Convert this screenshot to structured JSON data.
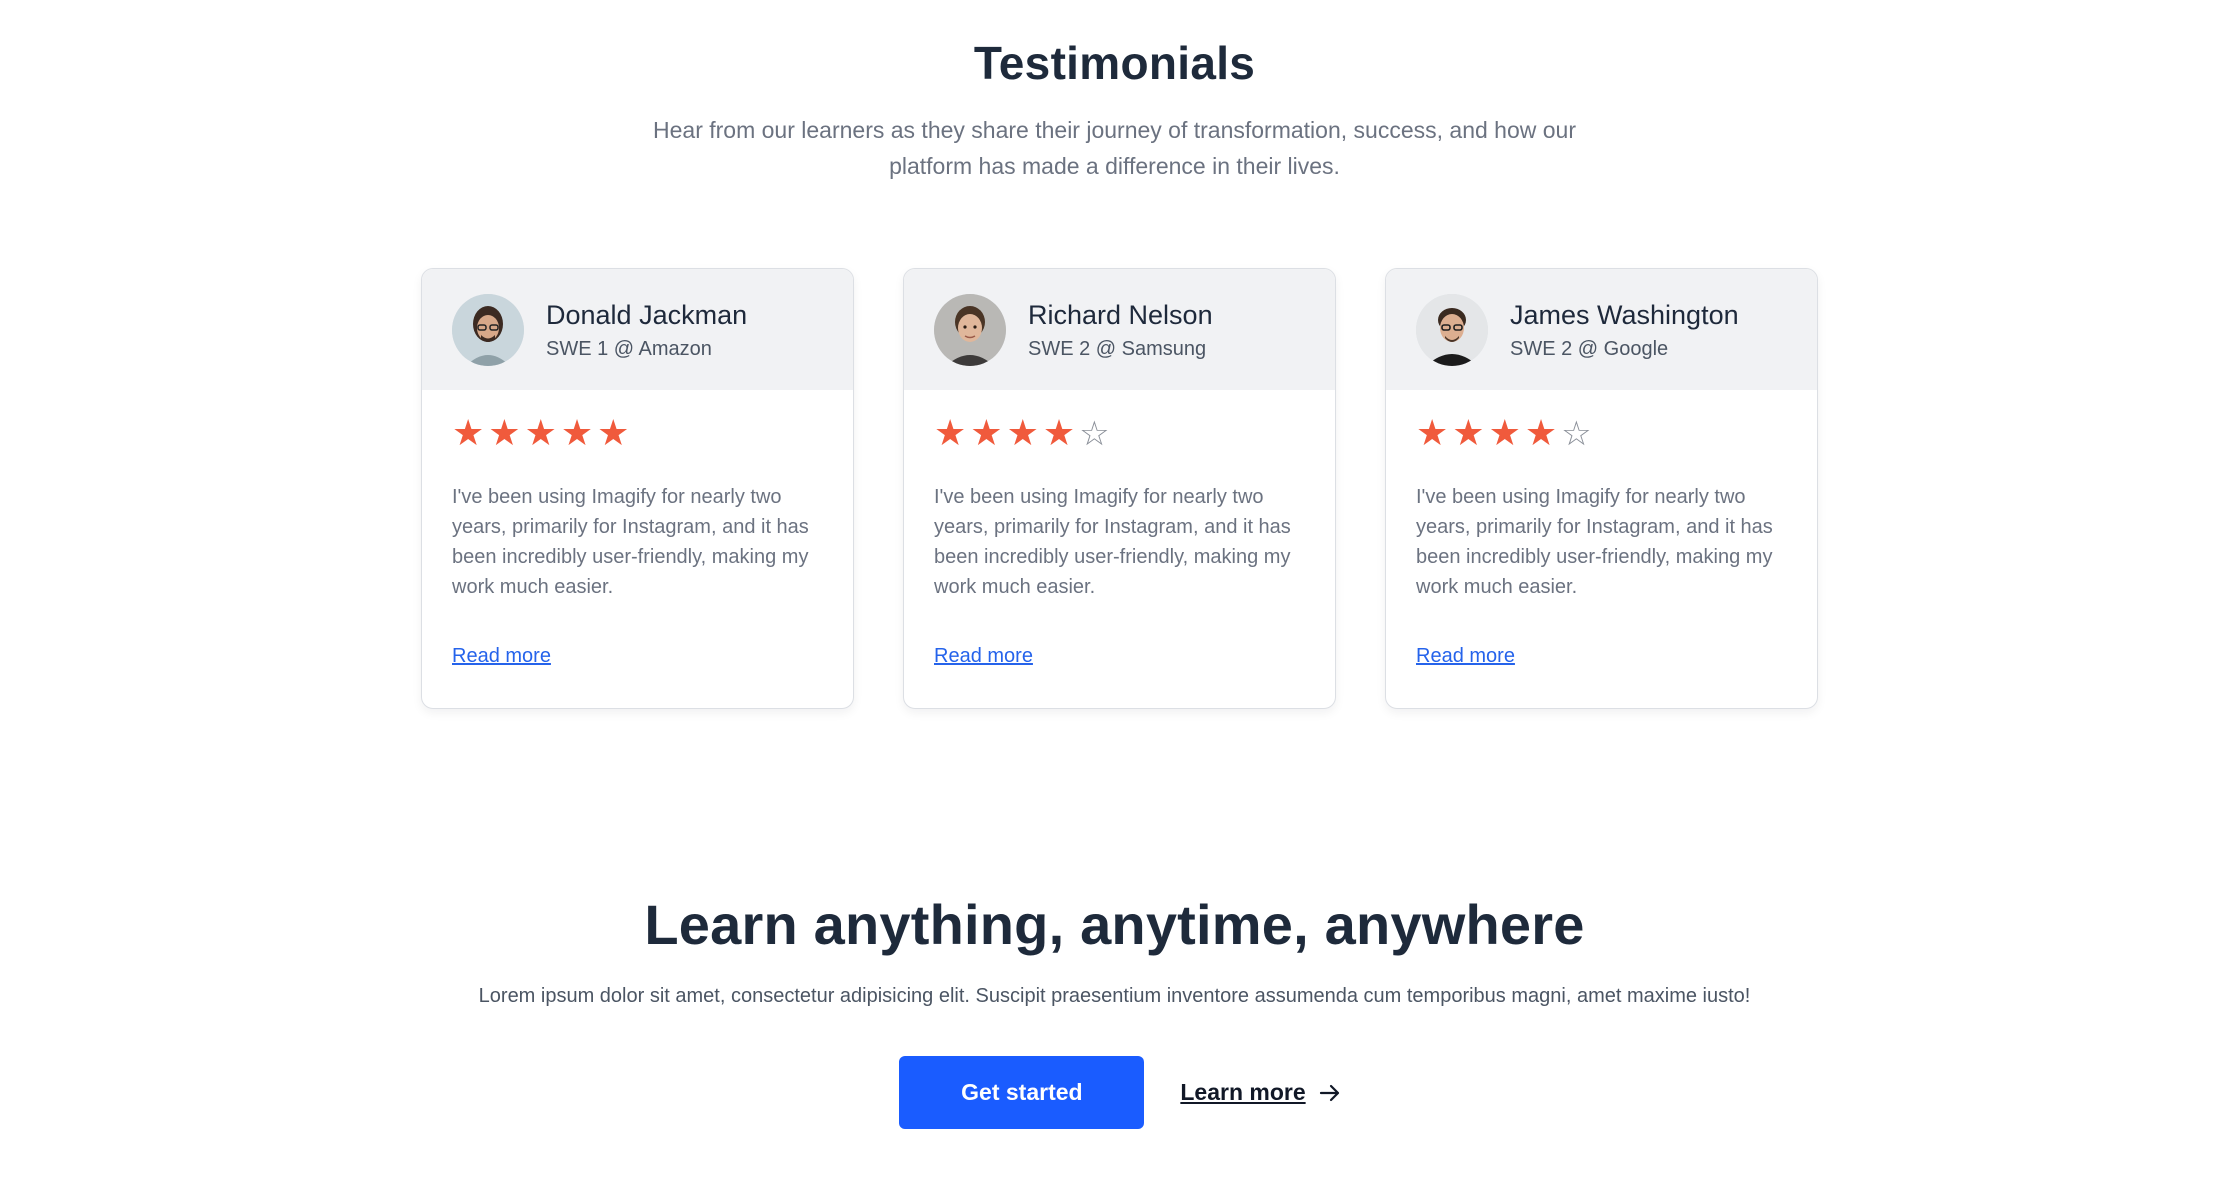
{
  "testimonials": {
    "title": "Testimonials",
    "subtitle": "Hear from our learners as they share their journey of transformation, success, and how our platform has made a difference in their lives."
  },
  "cards": [
    {
      "name": "Donald Jackman",
      "role": "SWE 1 @ Amazon",
      "rating": 5,
      "max_rating": 5,
      "stars": [
        "★",
        "★",
        "★",
        "★",
        "★"
      ],
      "quote": "I've been using Imagify for nearly two years, primarily for Instagram, and it has been incredibly user-friendly, making my work much easier.",
      "link": "Read more"
    },
    {
      "name": "Richard Nelson",
      "role": "SWE 2 @ Samsung",
      "rating": 4,
      "max_rating": 5,
      "stars": [
        "★",
        "★",
        "★",
        "★",
        "☆"
      ],
      "quote": "I've been using Imagify for nearly two years, primarily for Instagram, and it has been incredibly user-friendly, making my work much easier.",
      "link": "Read more"
    },
    {
      "name": "James Washington",
      "role": "SWE 2 @ Google",
      "rating": 4,
      "max_rating": 5,
      "stars": [
        "★",
        "★",
        "★",
        "★",
        "☆"
      ],
      "quote": "I've been using Imagify for nearly two years, primarily for Instagram, and it has been incredibly user-friendly, making my work much easier.",
      "link": "Read more"
    }
  ],
  "cta": {
    "title": "Learn anything, anytime, anywhere",
    "text": "Lorem ipsum dolor sit amet, consectetur adipisicing elit. Suscipit praesentium inventore assumenda cum temporibus magni, amet maxime iusto!",
    "primary_label": "Get started",
    "secondary_label": "Learn more",
    "secondary_icon": "arrow-right-icon"
  },
  "colors": {
    "accent": "#1a5cff",
    "star": "#f05a3c",
    "link": "#2563eb"
  }
}
